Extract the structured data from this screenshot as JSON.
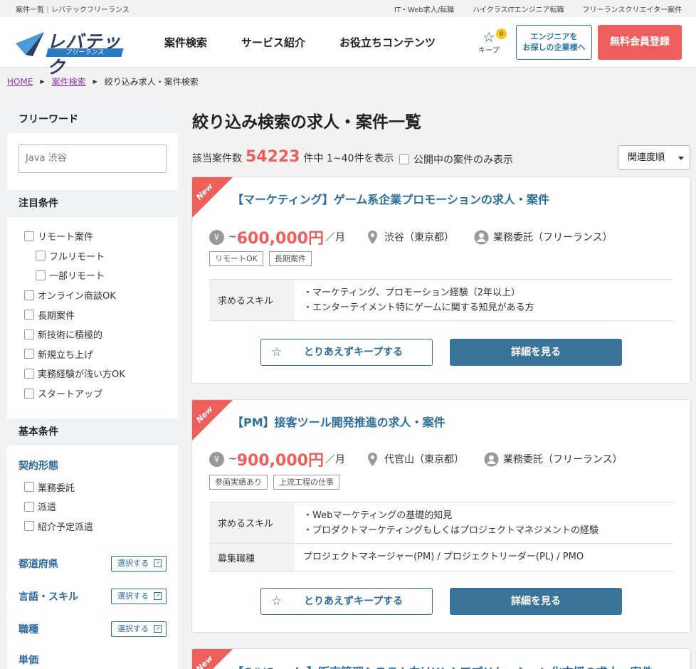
{
  "topbar": {
    "left": "案件一覧｜レバテックフリーランス",
    "links": [
      "IT・Web求人/転職",
      "ハイクラスITエンジニア転職",
      "フリーランスクリエイター案件"
    ]
  },
  "header": {
    "logo_main": "レバテック",
    "logo_sub": "フリーランス",
    "nav": [
      "案件検索",
      "サービス紹介",
      "お役立ちコンテンツ"
    ],
    "keep_label": "キープ",
    "keep_count": "0",
    "corp_btn_line1": "エンジニアを",
    "corp_btn_line2": "お探しの企業様へ",
    "signup": "無料会員登録"
  },
  "breadcrumb": {
    "home": "HOME",
    "search": "案件検索",
    "current": "絞り込み求人・案件検索"
  },
  "sidebar": {
    "freeword_title": "フリーワード",
    "freeword_placeholder": "Java 渋谷",
    "focus_title": "注目条件",
    "focus_items": [
      {
        "label": "リモート案件",
        "sub": false
      },
      {
        "label": "フルリモート",
        "sub": true
      },
      {
        "label": "一部リモート",
        "sub": true
      },
      {
        "label": "オンライン商談OK",
        "sub": false
      },
      {
        "label": "長期案件",
        "sub": false
      },
      {
        "label": "新技術に積極的",
        "sub": false
      },
      {
        "label": "新規立ち上げ",
        "sub": false
      },
      {
        "label": "実務経験が浅い方OK",
        "sub": false
      },
      {
        "label": "スタートアップ",
        "sub": false
      }
    ],
    "basic_title": "基本条件",
    "contract_title": "契約形態",
    "contract_items": [
      "業務委託",
      "派遣",
      "紹介予定派遣"
    ],
    "select_rows": [
      {
        "label": "都道府県",
        "button": "選択する"
      },
      {
        "label": "言語・スキル",
        "button": "選択する"
      },
      {
        "label": "職種",
        "button": "選択する"
      }
    ],
    "price_title": "単価"
  },
  "main": {
    "title": "絞り込み検索の求人・案件一覧",
    "count_prefix": "該当案件数",
    "count": "54223",
    "count_suffix": "件中 1~40件を表示",
    "only_open": "公開中の案件のみ表示",
    "sort": "関連度順"
  },
  "cards": [
    {
      "ribbon": "New",
      "title": "【マーケティング】ゲーム系企業プロモーションの求人・案件",
      "price_prefix": "~",
      "price": "600,000円",
      "price_unit": "／月",
      "location": "渋谷（東京都）",
      "contract": "業務委託（フリーランス）",
      "tags": [
        "リモートOK",
        "長期案件"
      ],
      "details": [
        {
          "key": "求めるスキル",
          "lines": [
            "・マーケティング、プロモーション経験（2年以上）",
            "・エンターテイメント特にゲームに関する知見がある方"
          ]
        }
      ],
      "keep_btn": "とりあえずキープする",
      "detail_btn": "詳細を見る"
    },
    {
      "ribbon": "New",
      "title": "【PM】接客ツール開発推進の求人・案件",
      "price_prefix": "~",
      "price": "900,000円",
      "price_unit": "／月",
      "location": "代官山（東京都）",
      "contract": "業務委託（フリーランス）",
      "tags": [
        "参画実績あり",
        "上流工程の仕事"
      ],
      "details": [
        {
          "key": "求めるスキル",
          "lines": [
            "・Webマーケティングの基礎的知見",
            "・プロダクトマーケティングもしくはプロジェクトマネジメントの経験"
          ]
        },
        {
          "key": "募集職種",
          "lines": [
            "プロジェクトマネージャー(PM) / プロジェクトリーダー(PL) / PMO"
          ]
        }
      ],
      "keep_btn": "とりあえずキープする",
      "detail_btn": "詳細を見る"
    },
    {
      "ribbon": "New",
      "title": "【C#/Oracle】販売管理システム向けWebアプリケーション化支援の求人・案件"
    }
  ],
  "icons": {
    "yen": "¥",
    "star": "☆",
    "ext": "↗"
  }
}
